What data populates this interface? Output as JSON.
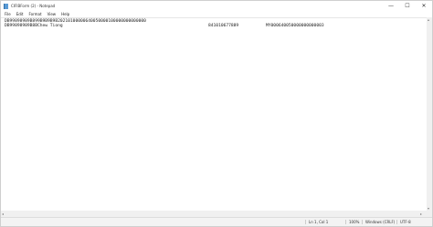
{
  "window": {
    "title": "CIFIBForm (2) - Notepad",
    "controls": {
      "minimize": "—",
      "maximize": "☐",
      "close": "✕"
    }
  },
  "menu": [
    "File",
    "Edit",
    "Format",
    "View",
    "Help"
  ],
  "document": {
    "line1": "DB99898989B899B9B9B9B20210100000640050000100000000000000",
    "line2_left": "DB99898989B8BChew Tiong",
    "line2_mid": "841010677889",
    "line2_right": "MY000640050000000000003"
  },
  "status": {
    "position": "Ln 1, Col 1",
    "zoom": "100%",
    "line_ending": "Windows (CRLF)",
    "encoding": "UTF-8"
  }
}
